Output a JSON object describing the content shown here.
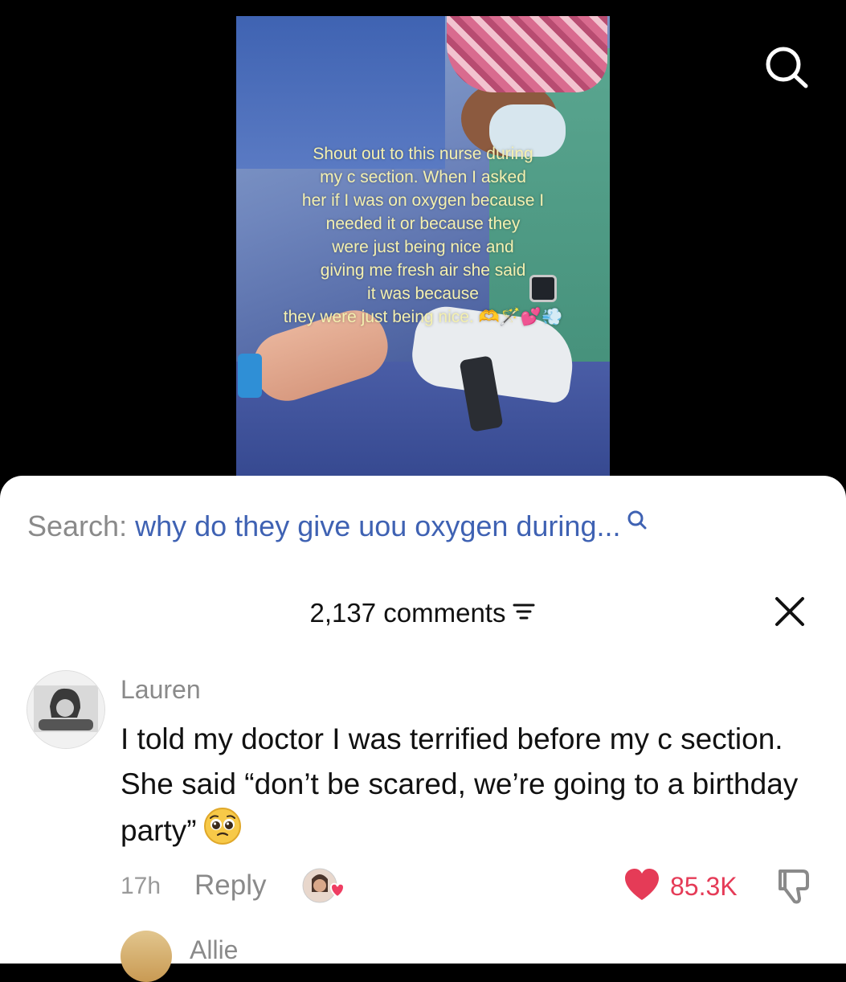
{
  "video": {
    "caption": "Shout out to this nurse during\nmy c section. When I asked\nher if I was on oxygen because I\nneeded it or because they\nwere just being nice and\ngiving me fresh air she said\nit was because\nthey were just being nice. 🫶🪄💕💨"
  },
  "sheet": {
    "search_prefix": "Search:",
    "search_query": "why do they give uou oxygen during...",
    "comments_count": "2,137 comments"
  },
  "comments": [
    {
      "author": "Lauren",
      "text": "I told my doctor I was terrified before my c section. She said “don’t be scared, we’re going to a birthday party”",
      "emoji": "🥹",
      "time": "17h",
      "reply_label": "Reply",
      "likes": "85.3K"
    },
    {
      "author": "Allie"
    }
  ],
  "colors": {
    "accent_blue": "#3f62b3",
    "like_red": "#e53b57",
    "caption_yellow": "#f4f0b0"
  },
  "icons": [
    "search-icon",
    "filter-icon",
    "close-icon",
    "heart-icon",
    "dislike-icon",
    "creator-liked-icon",
    "pleading-face-emoji"
  ]
}
